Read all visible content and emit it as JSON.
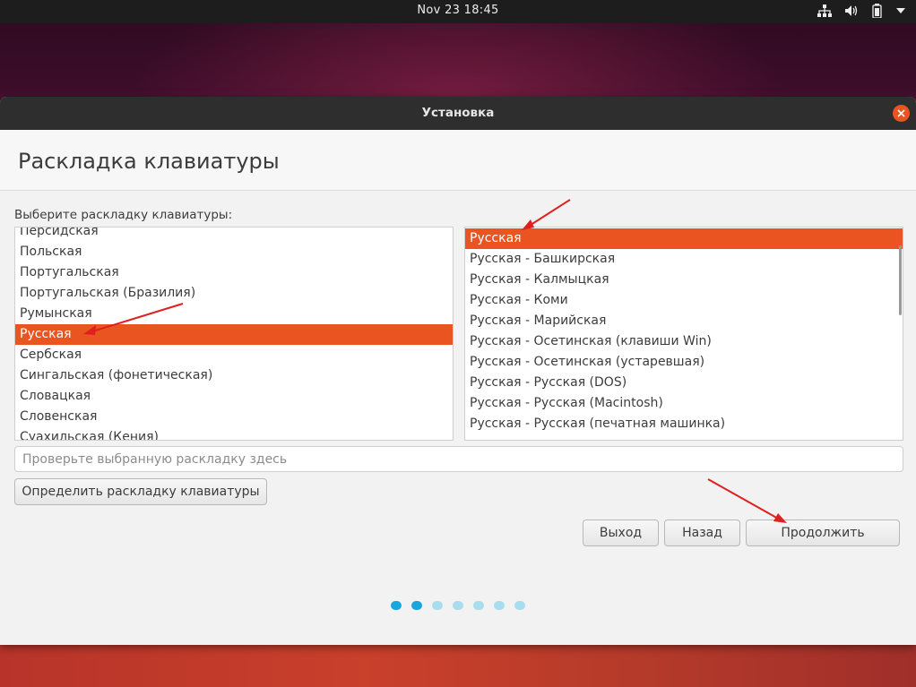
{
  "topbar": {
    "clock": "Nov 23  18:45",
    "tray_icons": [
      "network-icon",
      "volume-icon",
      "battery-icon",
      "system-menu-arrow-icon"
    ]
  },
  "window": {
    "title": "Установка",
    "page_title": "Раскладка клавиатуры",
    "prompt": "Выберите раскладку клавиатуры:"
  },
  "layouts": {
    "items": [
      {
        "label": "Персидская"
      },
      {
        "label": "Польская"
      },
      {
        "label": "Португальская"
      },
      {
        "label": "Португальская (Бразилия)"
      },
      {
        "label": "Румынская"
      },
      {
        "label": "Русская",
        "selected": true
      },
      {
        "label": "Сербская"
      },
      {
        "label": "Сингальская (фонетическая)"
      },
      {
        "label": "Словацкая"
      },
      {
        "label": "Словенская"
      },
      {
        "label": "Суахильская (Кения)"
      }
    ]
  },
  "variants": {
    "items": [
      {
        "label": "Русская",
        "selected": true
      },
      {
        "label": "Русская - Башкирская"
      },
      {
        "label": "Русская - Калмыцкая"
      },
      {
        "label": "Русская - Коми"
      },
      {
        "label": "Русская - Марийская"
      },
      {
        "label": "Русская - Осетинская (клавиши Win)"
      },
      {
        "label": "Русская - Осетинская (устаревшая)"
      },
      {
        "label": "Русская - Русская (DOS)"
      },
      {
        "label": "Русская - Русская (Macintosh)"
      },
      {
        "label": "Русская - Русская (печатная машинка)"
      }
    ]
  },
  "test_field": {
    "placeholder": "Проверьте выбранную раскладку здесь",
    "value": ""
  },
  "buttons": {
    "detect": "Определить раскладку клавиатуры",
    "quit": "Выход",
    "back": "Назад",
    "continue": "Продолжить"
  },
  "progress": {
    "total_steps": 7,
    "current_step": 2
  },
  "colors": {
    "accent": "#e95420",
    "titlebar": "#2e2e2e",
    "dot_active": "#19a6df",
    "dot_inactive": "#a8dcef",
    "annotation_arrow": "#e01f1f"
  }
}
